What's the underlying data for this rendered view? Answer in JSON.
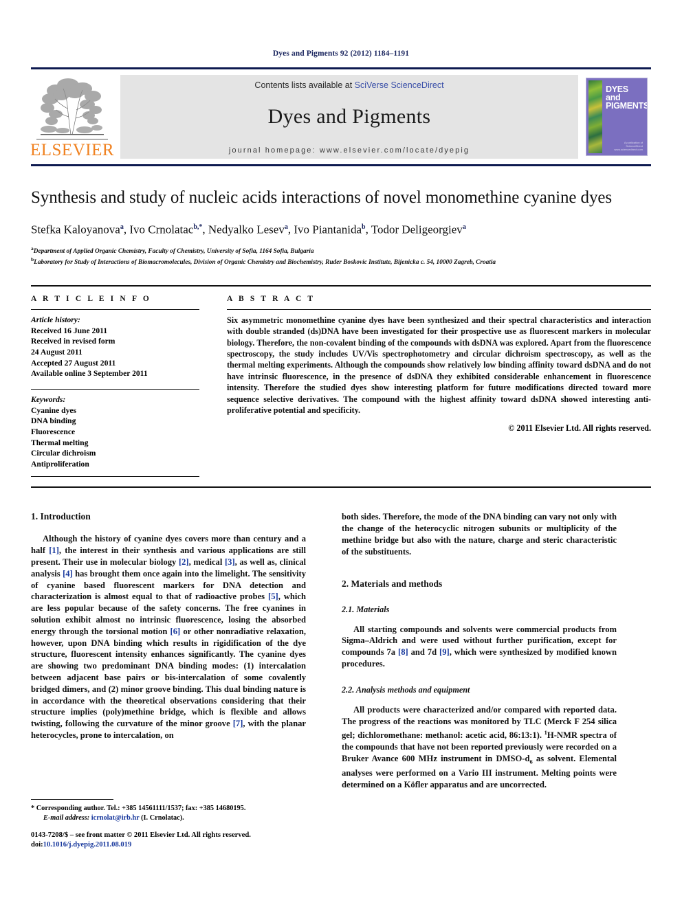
{
  "running_head": "Dyes and Pigments 92 (2012) 1184–1191",
  "masthead": {
    "publisher": "ELSEVIER",
    "contents_prefix": "Contents lists available at ",
    "contents_link": "SciVerse ScienceDirect",
    "journal_title": "Dyes and Pigments",
    "homepage": "journal homepage: www.elsevier.com/locate/dyepig",
    "cover": {
      "line1": "DYES",
      "line2": "and",
      "line3": "PIGMENTS",
      "footer_small": "A publication of",
      "footer_brand": "ScienceDirect",
      "footer_url": "www.sciencedirect.com",
      "bg_color": "#7b6fc0"
    }
  },
  "article": {
    "title": "Synthesis and study of nucleic acids interactions of novel monomethine cyanine dyes",
    "authors_html": "Stefka Kaloyanova<sup>a</sup>, Ivo Crnolatac<sup>b,*</sup>, Nedyalko Lesev<sup>a</sup>, Ivo Piantanida<sup>b</sup>, Todor Deligeorgiev<sup>a</sup>",
    "affiliations": [
      "Department of Applied Organic Chemistry, Faculty of Chemistry, University of Sofia, 1164 Sofia, Bulgaria",
      "Laboratory for Study of Interactions of Biomacromolecules, Division of Organic Chemistry and Biochemistry, Ruder Boskovic Institute, Bijenicka c. 54, 10000 Zagreb, Croatia"
    ],
    "affiliation_marks": [
      "a",
      "b"
    ]
  },
  "article_info": {
    "heading": "A R T I C L E   I N F O",
    "history_label": "Article history:",
    "history": [
      "Received 16 June 2011",
      "Received in revised form",
      "24 August 2011",
      "Accepted 27 August 2011",
      "Available online 3 September 2011"
    ],
    "keywords_label": "Keywords:",
    "keywords": [
      "Cyanine dyes",
      "DNA binding",
      "Fluorescence",
      "Thermal melting",
      "Circular dichroism",
      "Antiproliferation"
    ]
  },
  "abstract": {
    "heading": "A B S T R A C T",
    "text": "Six asymmetric monomethine cyanine dyes have been synthesized and their spectral characteristics and interaction with double stranded (ds)DNA have been investigated for their prospective use as fluorescent markers in molecular biology. Therefore, the non-covalent binding of the compounds with dsDNA was explored. Apart from the fluorescence spectroscopy, the study includes UV/Vis spectrophotometry and circular dichroism spectroscopy, as well as the thermal melting experiments. Although the compounds show relatively low binding affinity toward dsDNA and do not have intrinsic fluorescence, in the presence of dsDNA they exhibited considerable enhancement in fluorescence intensity. Therefore the studied dyes show interesting platform for future modifications directed toward more sequence selective derivatives. The compound with the highest affinity toward dsDNA showed interesting anti-proliferative potential and specificity.",
    "copyright": "© 2011 Elsevier Ltd. All rights reserved."
  },
  "body": {
    "left": {
      "intro_heading": "1. Introduction",
      "intro_p1_parts": [
        "Although the history of cyanine dyes covers more than century and a half ",
        "[1]",
        ", the interest in their synthesis and various applications are still present. Their use in molecular biology ",
        "[2]",
        ", medical ",
        "[3]",
        ", as well as, clinical analysis ",
        "[4]",
        " has brought them once again into the limelight. The sensitivity of cyanine based fluorescent markers for DNA detection and characterization is almost equal to that of radioactive probes ",
        "[5]",
        ", which are less popular because of the safety concerns. The free cyanines in solution exhibit almost no intrinsic fluorescence, losing the absorbed energy through the torsional motion ",
        "[6]",
        " or other nonradiative relaxation, however, upon DNA binding which results in rigidification of the dye structure, fluorescent intensity enhances significantly. The cyanine dyes are showing two predominant DNA binding modes: (1) intercalation between adjacent base pairs or bis-intercalation of some covalently bridged dimers, and (2) minor groove binding. This dual binding nature is in accordance with the theoretical observations considering that their structure implies (poly)methine bridge, which is flexible and allows twisting, following the curvature of the minor groove ",
        "[7]",
        ", with the planar heterocycles, prone to intercalation, on"
      ]
    },
    "right": {
      "cont_p": "both sides. Therefore, the mode of the DNA binding can vary not only with the change of the heterocyclic nitrogen subunits or multiplicity of the methine bridge but also with the nature, charge and steric characteristic of the substituents.",
      "mat_heading": "2. Materials and methods",
      "sub1_heading": "2.1. Materials",
      "sub1_parts": [
        "All starting compounds and solvents were commercial products from Sigma–Aldrich and were used without further purification, except for compounds 7a ",
        "[8]",
        " and 7d ",
        "[9]",
        ", which were synthesized by modified known procedures."
      ],
      "sub2_heading": "2.2. Analysis methods and equipment",
      "sub2_text_a": "All products were characterized and/or compared with reported data. The progress of the reactions was monitored by TLC (Merck F 254 silica gel; dichloromethane: methanol: acetic acid, 86:13:1). ",
      "sub2_sup": "1",
      "sub2_text_b": "H-NMR spectra of the compounds that have not been reported previously were recorded on a Bruker Avance 600 MHz instrument in DMSO-d",
      "sub2_sub": "6",
      "sub2_text_c": " as solvent. Elemental analyses were performed on a Vario III instrument. Melting points were determined on a Köfler apparatus and are uncorrected."
    }
  },
  "footnote": {
    "star": "*",
    "corresponding": "Corresponding author. Tel.: +385 14561111/1537; fax: +385 14680195.",
    "email_label": "E-mail address:",
    "email": "icrnolat@irb.hr",
    "email_suffix": "(I. Crnolatac)."
  },
  "footer": {
    "issn_line": "0143-7208/$ – see front matter © 2011 Elsevier Ltd. All rights reserved.",
    "doi_label": "doi:",
    "doi": "10.1016/j.dyepig.2011.08.019"
  }
}
